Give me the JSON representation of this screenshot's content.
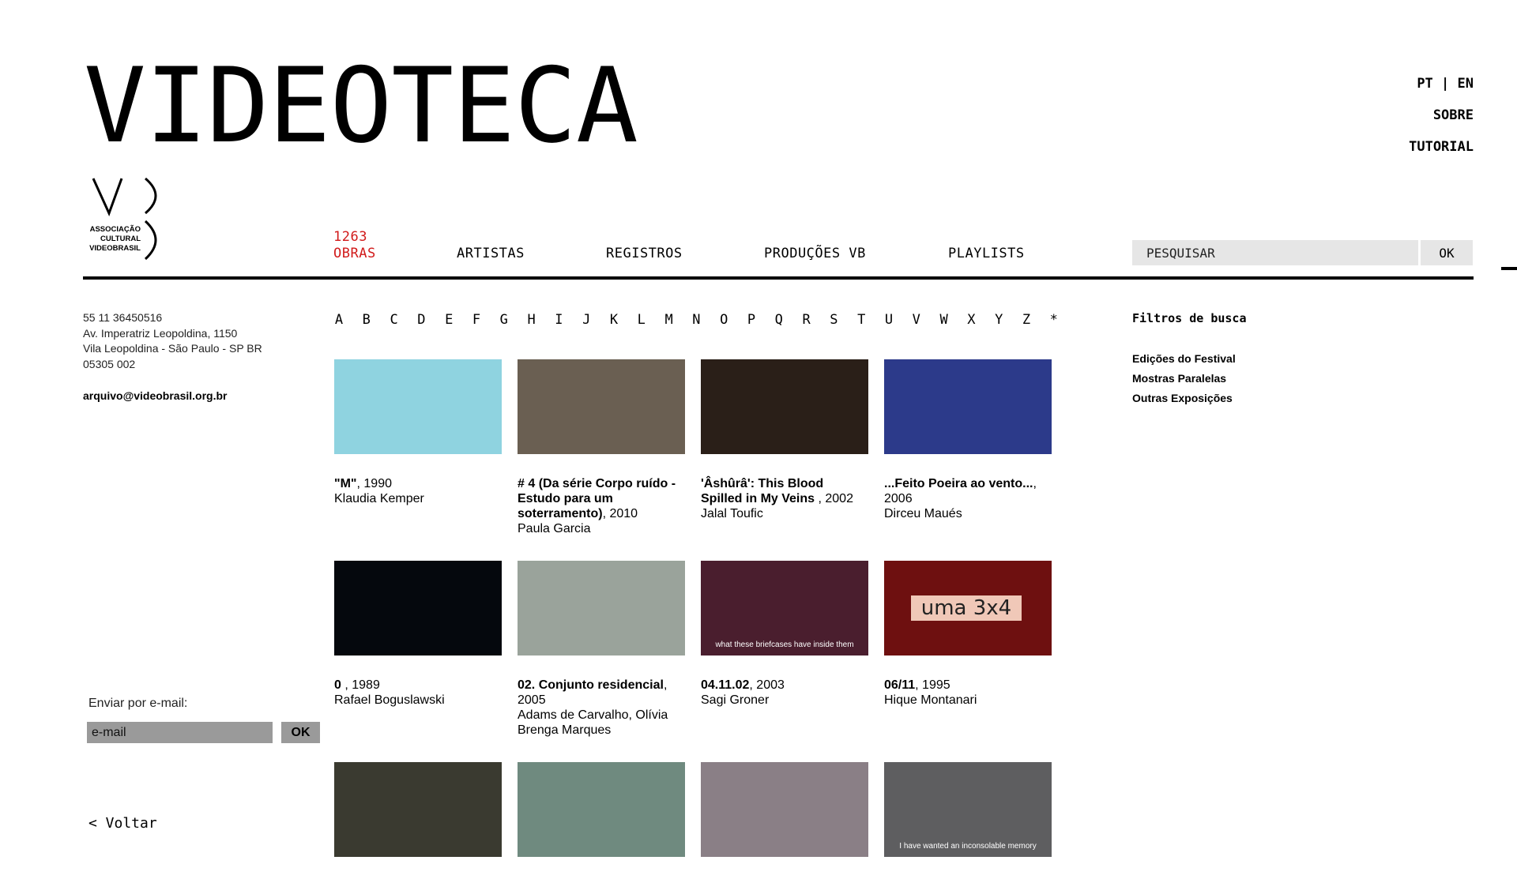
{
  "header": {
    "title": "VIDEOTECA",
    "lang_pt": "PT",
    "lang_sep": " | ",
    "lang_en": "EN",
    "sobre": "SOBRE",
    "tutorial": "TUTORIAL",
    "logo_text": [
      "ASSOCIAÇÃO",
      "CULTURAL",
      "VIDEOBRASIL"
    ]
  },
  "nav": {
    "obras_count": "1263",
    "obras": "OBRAS",
    "artistas": "ARTISTAS",
    "registros": "REGISTROS",
    "producoes": "PRODUÇÕES VB",
    "playlists": "PLAYLISTS",
    "search_placeholder": "PESQUISAR",
    "search_button": "OK",
    "active_color": "#d11a1a"
  },
  "contact": {
    "phone": "55 11 36450516",
    "street": "Av. Imperatriz Leopoldina, 1150",
    "city": "Vila Leopoldina - São Paulo - SP BR",
    "zip": "05305 002",
    "email": "arquivo@videobrasil.org.br"
  },
  "alphabet": [
    "A",
    "B",
    "C",
    "D",
    "E",
    "F",
    "G",
    "H",
    "I",
    "J",
    "K",
    "L",
    "M",
    "N",
    "O",
    "P",
    "Q",
    "R",
    "S",
    "T",
    "U",
    "V",
    "W",
    "X",
    "Y",
    "Z",
    "*"
  ],
  "filters": {
    "title": "Filtros de busca",
    "items": [
      "Edições do Festival",
      "Mostras Paralelas",
      "Outras Exposições"
    ]
  },
  "works": [
    {
      "title": "\"M\"",
      "year": ", 1990",
      "artist": "Klaudia Kemper",
      "thumb_color": "#8fd3e0"
    },
    {
      "title": "# 4 (Da série Corpo ruído - Estudo para um soterramento)",
      "year": ", 2010",
      "artist": "Paula Garcia",
      "thumb_color": "#6a5f52"
    },
    {
      "title": "'Âshûrâ': This Blood Spilled in My Veins",
      "year": " , 2002",
      "artist": "Jalal Toufic",
      "thumb_color": "#2a1f18"
    },
    {
      "title": "...Feito Poeira ao vento...",
      "year": ", 2006",
      "artist": "Dirceu Maués",
      "thumb_color": "#2c3a8a"
    },
    {
      "title": "0",
      "year": "  , 1989",
      "artist": "Rafael Boguslawski",
      "thumb_color": "#05080d"
    },
    {
      "title": "02. Conjunto residencial",
      "year": ", 2005",
      "artist": "Adams de Carvalho, Olívia Brenga Marques",
      "thumb_color": "#9aa39b"
    },
    {
      "title": "04.11.02",
      "year": ", 2003",
      "artist": "Sagi Groner",
      "thumb_color": "#4a1e2e",
      "caption": "what these briefcases have inside them"
    },
    {
      "title": "06/11",
      "year": ", 1995",
      "artist": "Hique Montanari",
      "thumb_color": "#6e1010",
      "caption": "uma 3x4"
    },
    {
      "title": "",
      "year": "",
      "artist": "",
      "thumb_color": "#3a3a30"
    },
    {
      "title": "",
      "year": "",
      "artist": "",
      "thumb_color": "#6f8a7f"
    },
    {
      "title": "",
      "year": "",
      "artist": "",
      "thumb_color": "#8a7f86"
    },
    {
      "title": "",
      "year": "",
      "artist": "",
      "thumb_color": "#5e5e60",
      "caption": "I have wanted an inconsolable memory"
    }
  ],
  "email_form": {
    "label": "Enviar por e-mail:",
    "placeholder": "e-mail",
    "button": "OK"
  },
  "back": "< Voltar"
}
